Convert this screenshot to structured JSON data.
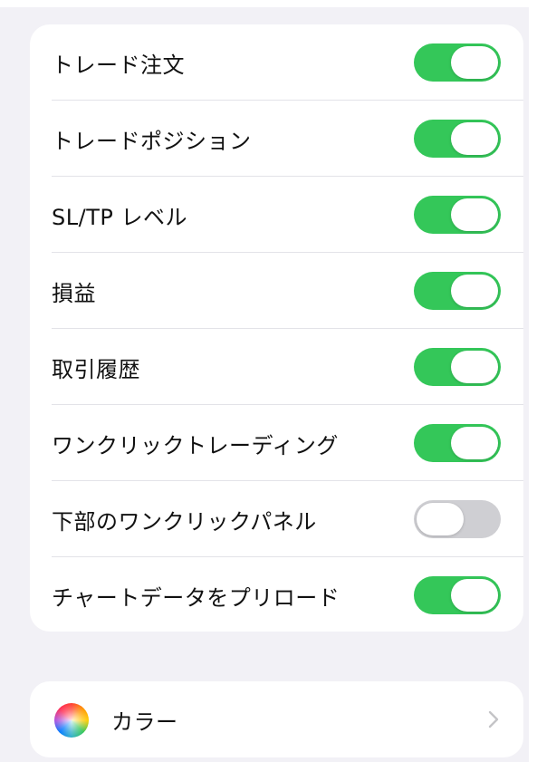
{
  "settings": {
    "rows": [
      {
        "label": "トレード注文",
        "enabled": true
      },
      {
        "label": "トレードポジション",
        "enabled": true
      },
      {
        "label": "SL/TP レベル",
        "enabled": true
      },
      {
        "label": "損益",
        "enabled": true
      },
      {
        "label": "取引履歴",
        "enabled": true
      },
      {
        "label": "ワンクリックトレーディング",
        "enabled": true
      },
      {
        "label": "下部のワンクリックパネル",
        "enabled": false
      },
      {
        "label": "チャートデータをプリロード",
        "enabled": true
      }
    ]
  },
  "color_section": {
    "label": "カラー",
    "icon": "color-wheel-icon",
    "chevron_icon": "chevron-right-icon"
  },
  "colors": {
    "background": "#f2f1f6",
    "toggle_on": "#34c759",
    "toggle_off": "#cfcfd3",
    "chevron": "#c4c4c7"
  }
}
